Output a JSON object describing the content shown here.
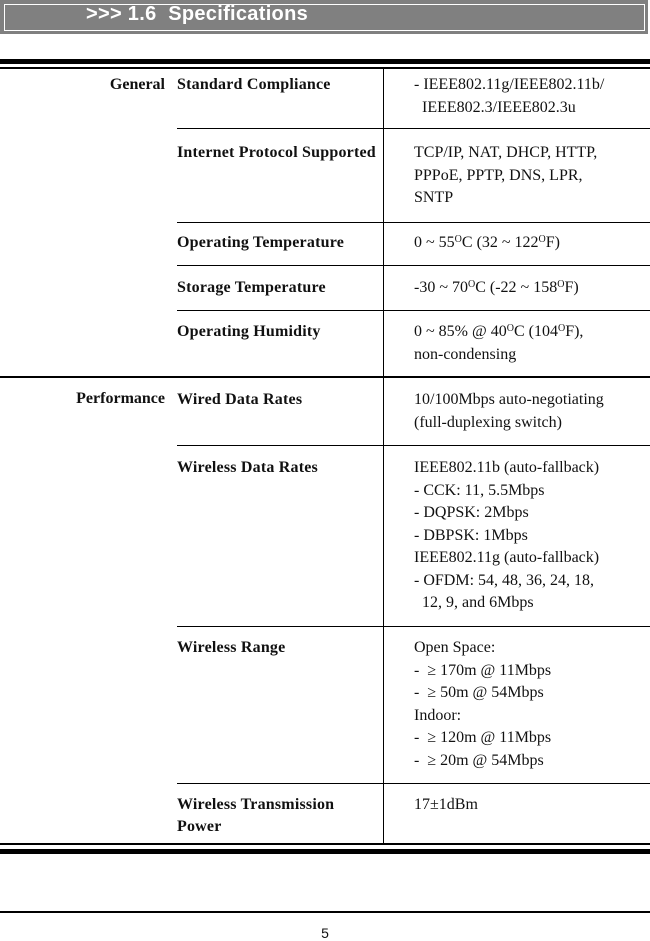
{
  "header": {
    "title": ">>> 1.6  Specifications"
  },
  "sections": [
    {
      "name": "General",
      "rows": [
        {
          "label": "Standard Compliance",
          "value": "- IEEE802.11g/IEEE802.11b/\n  IEEE802.3/IEEE802.3u"
        },
        {
          "label": "Internet Protocol Supported",
          "value": "TCP/IP, NAT, DHCP, HTTP,\nPPPoE, PPTP, DNS, LPR,\nSNTP"
        },
        {
          "label": "Operating Temperature",
          "value": "0 ~ 55°C (32 ~ 122°F)"
        },
        {
          "label": "Storage Temperature",
          "value": "-30 ~ 70°C (-22 ~ 158°F)"
        },
        {
          "label": "Operating Humidity",
          "value": "0 ~ 85% @ 40°C (104°F),\nnon-condensing"
        }
      ]
    },
    {
      "name": "Performance",
      "rows": [
        {
          "label": "Wired Data Rates",
          "value": "10/100Mbps auto-negotiating\n(full-duplexing switch)"
        },
        {
          "label": "Wireless Data Rates",
          "value": "IEEE802.11b (auto-fallback)\n- CCK: 11, 5.5Mbps\n- DQPSK: 2Mbps\n- DBPSK: 1Mbps\nIEEE802.11g (auto-fallback)\n- OFDM: 54, 48, 36, 24, 18,\n  12, 9, and 6Mbps"
        },
        {
          "label": "Wireless Range",
          "value": "Open Space:\n-  ≥ 170m @ 11Mbps\n-  ≥ 50m @ 54Mbps\nIndoor:\n-  ≥ 120m @ 11Mbps\n-  ≥ 20m @ 54Mbps"
        },
        {
          "label": "Wireless Transmission Power",
          "value": "17±1dBm"
        }
      ]
    }
  ],
  "footer": {
    "page_number": "5"
  }
}
